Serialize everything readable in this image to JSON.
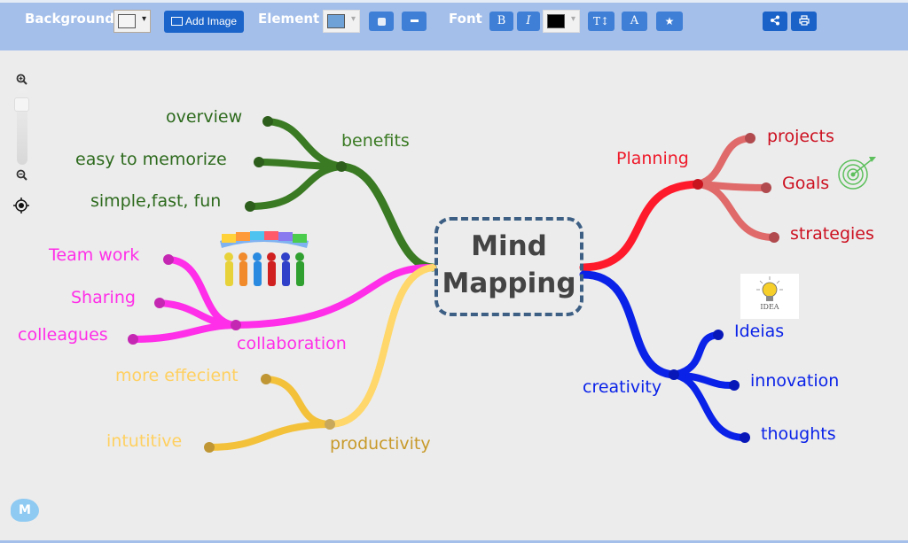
{
  "toolbar": {
    "background_label": "Background",
    "add_image_label": "Add Image",
    "element_label": "Element",
    "font_label": "Font",
    "bold_label": "B",
    "italic_label": "I",
    "text_size_label": "T↕",
    "font_style_label": "A",
    "star_label": "★",
    "dropdown_arrow": "▾",
    "background_color": "#f4f4f4",
    "element_color": "#6fa3d8",
    "font_color": "#000000"
  },
  "zoom_controls": {
    "zoom_in": "+",
    "zoom_out": "−"
  },
  "mindmap": {
    "center": {
      "line1": "Mind",
      "line2": "Mapping",
      "border_color": "#3d5f84"
    },
    "branches": [
      {
        "id": "benefits",
        "label": "benefits",
        "color": "#3a7a23",
        "children": [
          "overview",
          "easy to memorize",
          "simple,fast, fun"
        ]
      },
      {
        "id": "collaboration",
        "label": "collaboration",
        "color": "#ff2ee8",
        "children": [
          "Team work",
          "Sharing",
          "colleagues"
        ]
      },
      {
        "id": "productivity",
        "label": "productivity",
        "color": "#f3c13a",
        "children": [
          "more effecient",
          "intutitive"
        ]
      },
      {
        "id": "planning",
        "label": "Planning",
        "color": "#ff1a2b",
        "children": [
          "projects",
          "Goals",
          "strategies"
        ]
      },
      {
        "id": "creativity",
        "label": "creativity",
        "color": "#0a22e8",
        "children": [
          "Ideias",
          "innovation",
          "thoughts"
        ]
      }
    ],
    "idea_image_caption": "IDEA"
  },
  "logo": {
    "letter": "M"
  }
}
